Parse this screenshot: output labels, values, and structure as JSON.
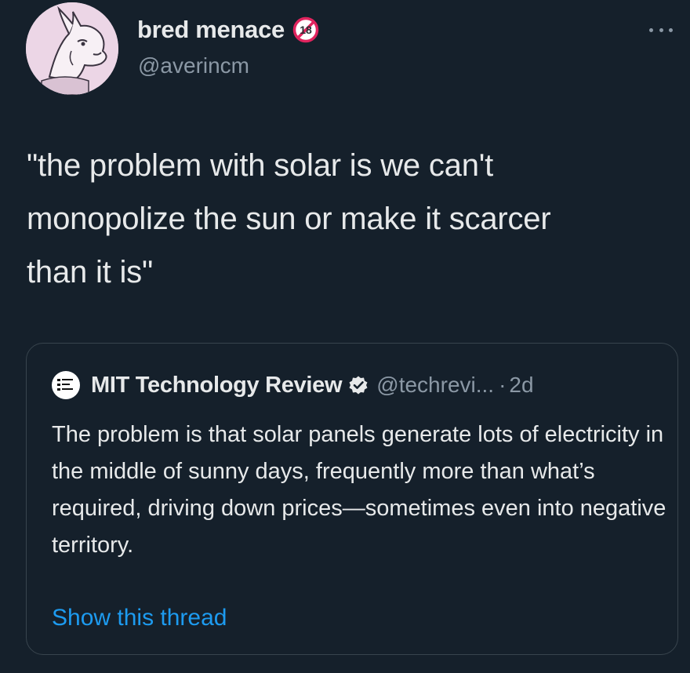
{
  "author": {
    "display_name": "bred menace",
    "handle": "@averincm",
    "badge_icon": "age-18-icon",
    "avatar_icon": "cartoon-dog-avatar"
  },
  "tweet": {
    "text": "\"the problem with solar is we can't\nmonopolize the sun or make it scarcer\nthan it is\""
  },
  "quoted": {
    "display_name": "MIT Technology Review",
    "handle": "@techrevi...",
    "separator": "·",
    "time": "2d",
    "text": "The problem is that solar panels generate lots of electricity in the middle of sunny days, frequently more than what’s required, driving down prices—sometimes even into negative territory.",
    "show_thread_label": "Show this thread",
    "verified_icon": "verified-badge-icon"
  },
  "colors": {
    "background": "#15202b",
    "primary_text": "#e7e9ea",
    "secondary_text": "#8b98a5",
    "link": "#1d9bf0",
    "border": "#38444d"
  }
}
